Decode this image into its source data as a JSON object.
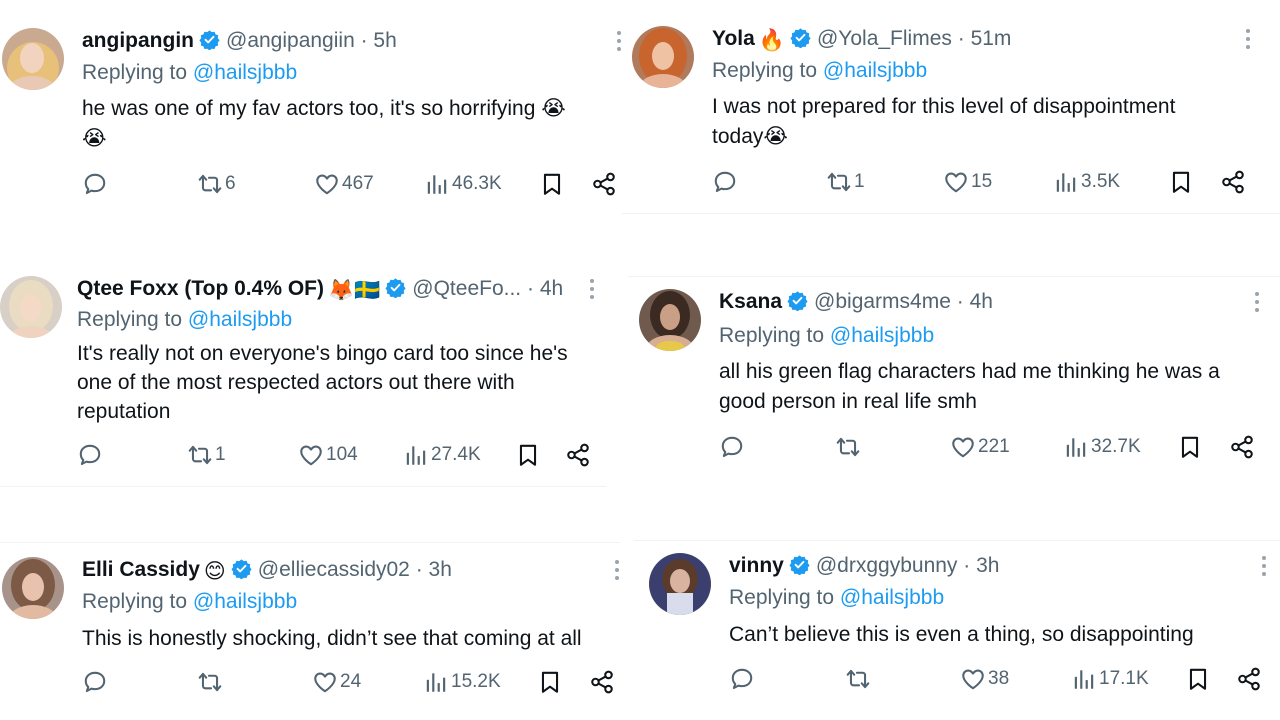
{
  "colors": {
    "accent": "#1d9bf0",
    "muted": "#536471",
    "text": "#0f1419",
    "divider": "#eff3f4"
  },
  "icons": {
    "reply": "reply-icon",
    "retweet": "retweet-icon",
    "like": "heart-icon",
    "views": "views-icon",
    "bookmark": "bookmark-icon",
    "share": "share-icon",
    "verified": "verified-badge-icon",
    "more": "more-dots-icon"
  },
  "tweets": [
    {
      "name": "angipangin",
      "handle": "@angipangiin",
      "sep": " · ",
      "time": "5h",
      "reply_prefix": "Replying to ",
      "reply_to": "@hailsjbbb",
      "text": [
        "he was one of my fav actors too, it's so horrifying 😭",
        "😭"
      ],
      "stats": {
        "retweets": "6",
        "likes": "467",
        "views": "46.3K"
      }
    },
    {
      "name": "Yola",
      "name_emoji": "🔥",
      "handle": "@Yola_Flimes",
      "sep": " · ",
      "time": "51m",
      "reply_prefix": "Replying to ",
      "reply_to": "@hailsjbbb",
      "text": [
        "I was not prepared for this level of disappointment",
        "today😭"
      ],
      "stats": {
        "retweets": "1",
        "likes": "15",
        "views": "3.5K"
      }
    },
    {
      "name": "Qtee Foxx (Top 0.4% OF)",
      "name_emoji": "🦊🇸🇪",
      "handle": "@QteeFo...",
      "sep": " · ",
      "time": "4h",
      "reply_prefix": "Replying to ",
      "reply_to": "@hailsjbbb",
      "text": [
        "It's really not on everyone's bingo card too since he's",
        "one of the most respected actors out there with",
        "reputation"
      ],
      "stats": {
        "retweets": "1",
        "likes": "104",
        "views": "27.4K"
      }
    },
    {
      "name": "Ksana",
      "handle": "@bigarms4me",
      "sep": " · ",
      "time": "4h",
      "reply_prefix": "Replying to ",
      "reply_to": "@hailsjbbb",
      "text": [
        "all his green flag characters had me thinking he was a",
        "good person in real life smh"
      ],
      "stats": {
        "retweets": "",
        "likes": "221",
        "views": "32.7K"
      }
    },
    {
      "name": "Elli Cassidy",
      "name_emoji": "😊",
      "handle": "@elliecassidy02",
      "sep": " · ",
      "time": "3h",
      "reply_prefix": "Replying to ",
      "reply_to": "@hailsjbbb",
      "text": [
        "This is honestly shocking, didn’t see that coming at all"
      ],
      "stats": {
        "retweets": "",
        "likes": "24",
        "views": "15.2K"
      }
    },
    {
      "name": "vinny",
      "handle": "@drxggybunny",
      "sep": " · ",
      "time": "3h",
      "reply_prefix": "Replying to ",
      "reply_to": "@hailsjbbb",
      "text": [
        "Can’t believe this is even a thing, so disappointing"
      ],
      "stats": {
        "retweets": "",
        "likes": "38",
        "views": "17.1K"
      }
    }
  ]
}
